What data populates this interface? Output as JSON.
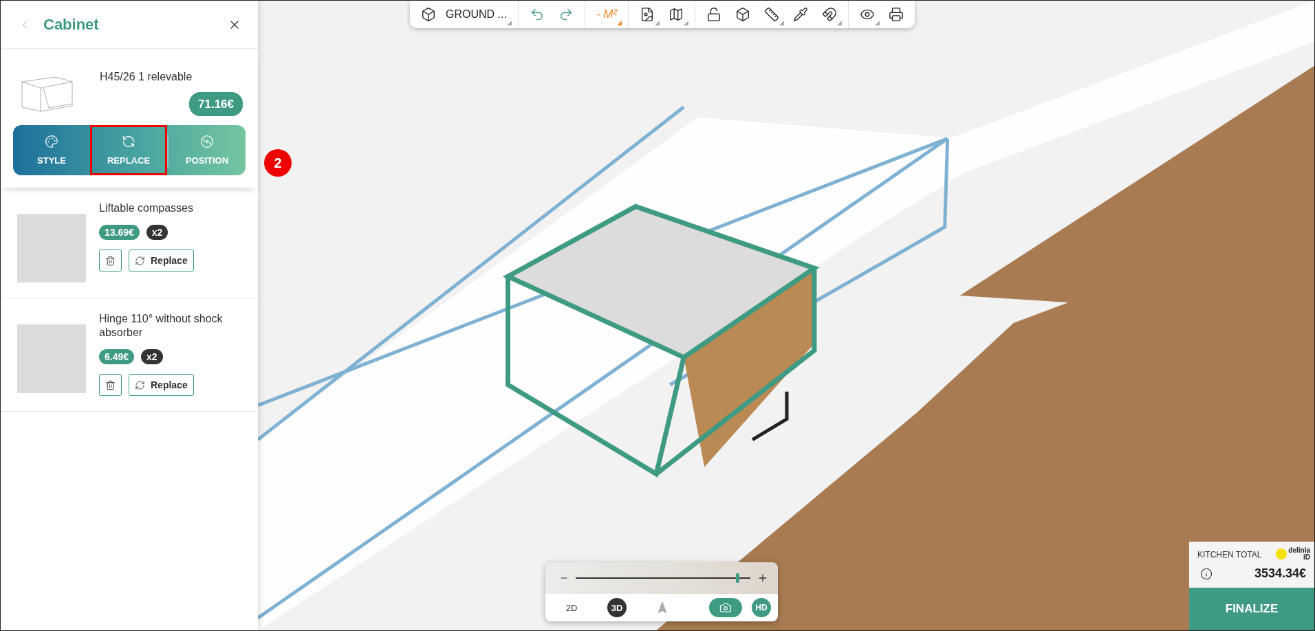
{
  "panel": {
    "title": "Cabinet"
  },
  "product": {
    "name": "H45/26 1 relevable",
    "price": "71.16€",
    "actions": [
      {
        "kind": "style",
        "label": "STYLE",
        "highlighted": false
      },
      {
        "kind": "replace",
        "label": "REPLACE",
        "highlighted": true
      },
      {
        "kind": "position",
        "label": "POSITION",
        "highlighted": false
      }
    ]
  },
  "step_badge": "2",
  "accessories": [
    {
      "name": "Liftable compasses",
      "price": "13.69€",
      "quantity": "x2",
      "replace_label": "Replace"
    },
    {
      "name": "Hinge 110° without shock absorber",
      "price": "6.49€",
      "quantity": "x2",
      "replace_label": "Replace"
    }
  ],
  "toolbar": {
    "groups": [
      {
        "items": [
          {
            "kind": "floor",
            "label": "GROUND ...",
            "menu": true
          }
        ]
      },
      {
        "items": [
          {
            "kind": "undo",
            "menu": false
          },
          {
            "kind": "redo",
            "menu": false
          }
        ]
      },
      {
        "items": [
          {
            "kind": "area",
            "label": "- M²",
            "menu": true
          }
        ]
      },
      {
        "items": [
          {
            "kind": "plan",
            "menu": true
          },
          {
            "kind": "map",
            "menu": true
          }
        ]
      },
      {
        "items": [
          {
            "kind": "lock",
            "menu": false
          },
          {
            "kind": "cube",
            "menu": false
          },
          {
            "kind": "ruler",
            "menu": true
          },
          {
            "kind": "pipette",
            "menu": false
          },
          {
            "kind": "magnet",
            "menu": true
          }
        ]
      },
      {
        "items": [
          {
            "kind": "eye",
            "menu": true
          },
          {
            "kind": "print",
            "menu": false
          }
        ]
      }
    ]
  },
  "view_controls": {
    "zoom": {
      "level": 0.93
    },
    "modes": [
      {
        "kind": "text",
        "label": "2D",
        "selected": false
      },
      {
        "kind": "text",
        "label": "3D",
        "selected": true
      },
      {
        "kind": "compass",
        "selected": false
      }
    ],
    "hd_label": "HD"
  },
  "total": {
    "label": "KITCHEN TOTAL",
    "logo_top": "delinia",
    "logo_bottom": "iD",
    "amount": "3534.34€",
    "button": "FINALIZE"
  }
}
